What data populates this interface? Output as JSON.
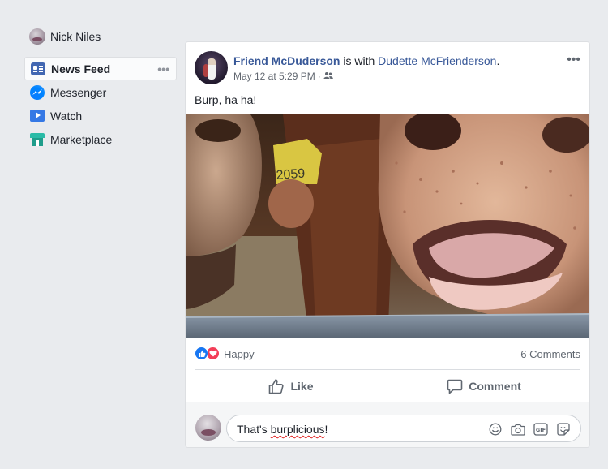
{
  "sidebar": {
    "profile_name": "Nick Niles",
    "items": [
      {
        "label": "News Feed",
        "icon": "news-feed-icon",
        "active": true
      },
      {
        "label": "Messenger",
        "icon": "messenger-icon"
      },
      {
        "label": "Watch",
        "icon": "watch-icon"
      },
      {
        "label": "Marketplace",
        "icon": "marketplace-icon"
      }
    ],
    "more": "•••"
  },
  "post": {
    "author": "Friend McDuderson",
    "with_text": " is with ",
    "tagged": "Dudette McFrienderson",
    "period": ".",
    "timestamp": "May 12 at 5:29 PM",
    "meta_sep": "·",
    "audience_icon": "friends-icon",
    "more": "•••",
    "text": "Burp, ha ha!",
    "image_icon": "cow-photo",
    "reactions": {
      "label": "Happy",
      "types": [
        "like",
        "love"
      ]
    },
    "comment_count": "6 Comments",
    "actions": {
      "like": "Like",
      "comment": "Comment"
    },
    "comment_box": {
      "prefix": "That's ",
      "misspelt": "burplicious",
      "suffix": "!",
      "icons": [
        "emoji-icon",
        "camera-icon",
        "gif-icon",
        "sticker-icon"
      ]
    }
  },
  "colors": {
    "background": "#e9ebee",
    "link": "#385898",
    "like_blue": "#1877f2",
    "love_red": "#f33e58"
  }
}
